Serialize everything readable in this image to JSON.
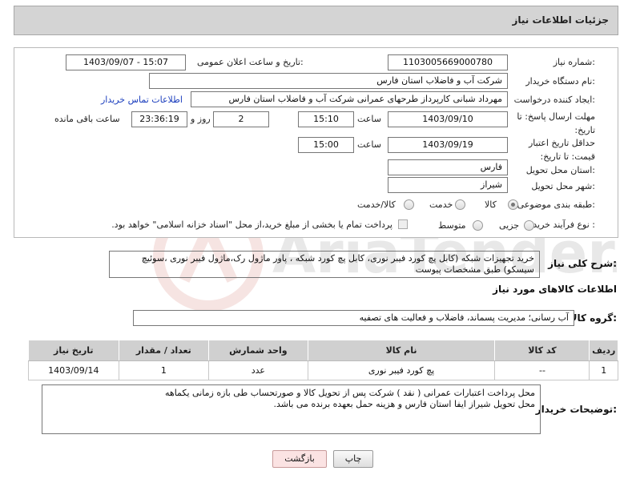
{
  "header": {
    "title": "جزئیات اطلاعات نیاز"
  },
  "form": {
    "need_number_label": "شماره نیاز:",
    "need_number": "1103005669000780",
    "announce_label": "تاریخ و ساعت اعلان عمومی:",
    "announce_value": "1403/09/07 - 15:07",
    "buyer_org_label": "نام دستگاه خریدار:",
    "buyer_org": "شرکت آب و فاضلاب استان فارس",
    "creator_label": "ایجاد کننده درخواست:",
    "creator": "مهرداد شبانی کارپرداز طرحهای عمرانی  شرکت آب و فاضلاب استان فارس",
    "contact_link": "اطلاعات تماس خریدار",
    "deadline_label": "مهلت ارسال پاسخ: تا تاریخ:",
    "deadline_date": "1403/09/10",
    "time_label": "ساعت",
    "deadline_time": "15:10",
    "days_value": "2",
    "days_label": "روز و",
    "remaining_time": "23:36:19",
    "remaining_label": "ساعت باقی مانده",
    "validity_label": "حداقل تاریخ اعتبار قیمت: تا تاریخ:",
    "validity_date": "1403/09/19",
    "validity_time": "15:00",
    "province_label": "استان محل تحویل:",
    "province": "فارس",
    "city_label": "شهر محل تحویل:",
    "city": "شیراز",
    "category_label": "طبقه بندی موضوعی:",
    "category_options": [
      "کالا",
      "خدمت",
      "کالا/خدمت"
    ],
    "process_label": "نوع فرآیند خرید :",
    "process_options": [
      "جزیی",
      "متوسط"
    ],
    "payment_note": "پرداخت تمام یا بخشی از مبلغ خرید،از محل \"اسناد خزانه اسلامی\" خواهد بود."
  },
  "description": {
    "label": "شرح کلی نیاز:",
    "text": "خرید تجهیزات شبکه (کابل پچ کورد فیبر نوری، کابل پچ کورد شبکه ، پاور ماژول رک،ماژول فیبر نوری ،سوئیچ سیسکو) طبق مشخصات پیوست"
  },
  "goods": {
    "section_title": "اطلاعات کالاهای مورد نیاز",
    "group_label": "گروه کالا:",
    "group_value": "آب رسانی؛ مدیریت پسماند، فاضلاب و فعالیت های تصفیه",
    "columns": [
      "ردیف",
      "کد کالا",
      "نام کالا",
      "واحد شمارش",
      "تعداد / مقدار",
      "تاریخ نیاز"
    ],
    "rows": [
      [
        "1",
        "--",
        "پچ کورد فیبر نوری",
        "عدد",
        "1",
        "1403/09/14"
      ]
    ]
  },
  "buyer_notes": {
    "label": "توضیحات خریدار:",
    "line1": "محل پرداخت اعتبارات عمرانی ( نقد )  شرکت پس از تحویل کالا و صورتحساب طی بازه زمانی یکماهه",
    "line2": "محل تحویل شیراز ایفا استان فارس و هزینه حمل بعهده برنده می باشد."
  },
  "buttons": {
    "print": "چاپ",
    "back": "بازگشت"
  },
  "colors": {
    "header_bg": "#d4d4d4",
    "table_header_bg": "#d0d0d0",
    "link": "#1a3dbd",
    "back_button_bg": "#fbe3e3"
  }
}
